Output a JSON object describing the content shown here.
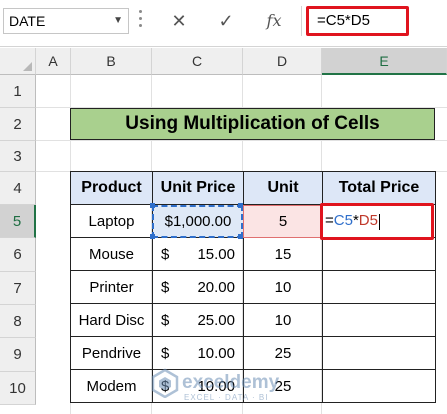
{
  "formula_bar": {
    "name_box": "DATE",
    "name_box_arrow_icon": "chevron-down-icon",
    "cancel_icon": "✕",
    "enter_icon": "✓",
    "fx_icon": "fx",
    "formula": "=C5*D5"
  },
  "columns": [
    "A",
    "B",
    "C",
    "D",
    "E"
  ],
  "selected_column": "E",
  "rows": [
    "1",
    "2",
    "3",
    "4",
    "5",
    "6",
    "7",
    "8",
    "9",
    "10"
  ],
  "selected_row": "5",
  "title": "Using Multiplication of Cells",
  "table": {
    "headers": [
      "Product",
      "Unit Price",
      "Unit",
      "Total Price"
    ],
    "rows": [
      {
        "product": "Laptop",
        "currency": "",
        "price": "$1,000.00",
        "unit": "5",
        "total_formula": {
          "eq": "=",
          "c": "C5",
          "op": "*",
          "d": "D5"
        }
      },
      {
        "product": "Mouse",
        "currency": "$",
        "price": "15.00",
        "unit": "15",
        "total": ""
      },
      {
        "product": "Printer",
        "currency": "$",
        "price": "20.00",
        "unit": "10",
        "total": ""
      },
      {
        "product": "Hard Disc",
        "currency": "$",
        "price": "25.00",
        "unit": "10",
        "total": ""
      },
      {
        "product": "Pendrive",
        "currency": "$",
        "price": "10.00",
        "unit": "25",
        "total": ""
      },
      {
        "product": "Modem",
        "currency": "$",
        "price": "10.00",
        "unit": "25",
        "total": ""
      }
    ]
  },
  "watermark": {
    "name": "exceldemy",
    "sub": "EXCEL · DATA · BI"
  },
  "colors": {
    "accent_red": "#e0141e",
    "title_fill": "#a9d08e",
    "header_fill": "#dde7f7",
    "ref_blue": "#2f6fcb",
    "ref_red": "#c0392b"
  }
}
